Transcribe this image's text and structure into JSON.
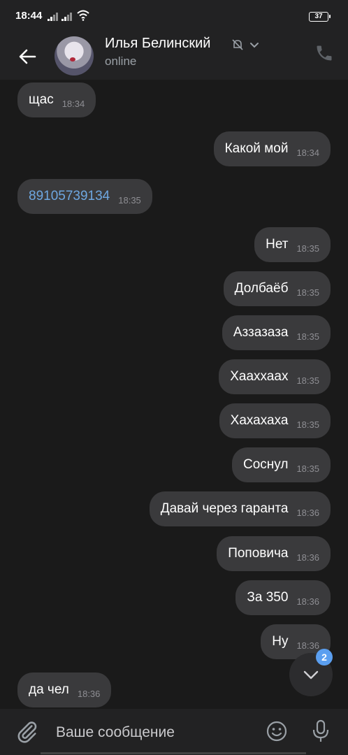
{
  "status_bar": {
    "time": "18:44",
    "battery": "37"
  },
  "header": {
    "contact_name": "Илья Белинский",
    "status": "online"
  },
  "messages": [
    {
      "text": "щас",
      "time": "18:34",
      "outgoing": false
    },
    {
      "text": "Какой мой",
      "time": "18:34",
      "outgoing": true
    },
    {
      "text": "89105739134",
      "time": "18:35",
      "outgoing": false,
      "is_link": true
    },
    {
      "text": "Нет",
      "time": "18:35",
      "outgoing": true
    },
    {
      "text": "Долбаёб",
      "time": "18:35",
      "outgoing": true
    },
    {
      "text": "Аззазаза",
      "time": "18:35",
      "outgoing": true
    },
    {
      "text": "Хааххаах",
      "time": "18:35",
      "outgoing": true
    },
    {
      "text": "Хахахаха",
      "time": "18:35",
      "outgoing": true
    },
    {
      "text": "Соснул",
      "time": "18:35",
      "outgoing": true
    },
    {
      "text": "Давай через гаранта",
      "time": "18:36",
      "outgoing": true
    },
    {
      "text": "Поповича",
      "time": "18:36",
      "outgoing": true
    },
    {
      "text": "За 350",
      "time": "18:36",
      "outgoing": true
    },
    {
      "text": "Ну",
      "time": "18:36",
      "outgoing": true
    },
    {
      "text": "да чел",
      "time": "18:36",
      "outgoing": false
    }
  ],
  "scroll_down": {
    "unread_count": "2"
  },
  "input": {
    "placeholder": "Ваше сообщение",
    "value": ""
  },
  "icons": {
    "back": "arrow-left-icon",
    "muted": "bell-off-icon",
    "dropdown": "chevron-down-icon",
    "call": "phone-icon",
    "attach": "paperclip-icon",
    "emoji": "smiley-icon",
    "mic": "microphone-icon",
    "scroll": "chevron-down-icon"
  },
  "colors": {
    "background": "#1a1a1a",
    "bar": "#222223",
    "bubble": "#3a3a3c",
    "link": "#6ea7e1",
    "badge": "#5b9ff0",
    "time_text": "#8e8e93"
  }
}
